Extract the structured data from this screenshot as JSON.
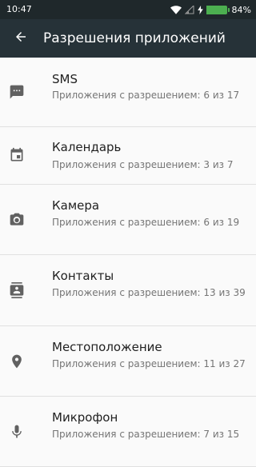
{
  "status_bar": {
    "time": "10:47",
    "battery_level": 0.84,
    "battery_text": "84%",
    "icons": [
      "wifi-icon",
      "cell-signal-icon",
      "charging-bolt-icon",
      "battery-icon"
    ]
  },
  "app_bar": {
    "title": "Разрешения приложений",
    "back_icon": "arrow-back-icon"
  },
  "colors": {
    "status_bar": "#1f282b",
    "app_bar": "#263238",
    "background": "#fafafa",
    "icon": "#616161",
    "title": "#212121",
    "subtitle": "#757575",
    "divider": "#e0e0e0",
    "battery": "#4caf50"
  },
  "permissions": [
    {
      "icon": "message-icon",
      "title": "SMS",
      "subtitle": "Приложения с разрешением: 6 из 17"
    },
    {
      "icon": "calendar-icon",
      "title": "Календарь",
      "subtitle": "Приложения с разрешением: 3 из 7"
    },
    {
      "icon": "camera-icon",
      "title": "Камера",
      "subtitle": "Приложения с разрешением: 6 из 19"
    },
    {
      "icon": "contacts-icon",
      "title": "Контакты",
      "subtitle": "Приложения с разрешением: 13 из 39"
    },
    {
      "icon": "location-icon",
      "title": "Местоположение",
      "subtitle": "Приложения с разрешением: 11 из 27"
    },
    {
      "icon": "microphone-icon",
      "title": "Микрофон",
      "subtitle": "Приложения с разрешением: 7 из 15"
    }
  ]
}
